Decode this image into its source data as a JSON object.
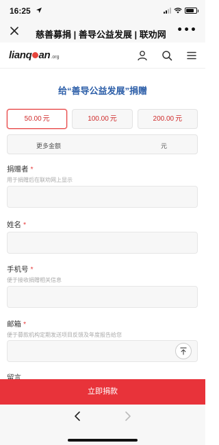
{
  "status_bar": {
    "time": "16:25"
  },
  "app_header": {
    "title": "慈善募捐 | 善导公益发展 | 联劝网"
  },
  "site_logo": {
    "text_before": "lianq",
    "text_after": "an",
    "suffix": ".org"
  },
  "form": {
    "title": "给“善导公益发展”捐赠",
    "amounts": [
      {
        "value": "50.00",
        "unit": "元",
        "selected": true
      },
      {
        "value": "100.00",
        "unit": "元",
        "selected": false
      },
      {
        "value": "200.00",
        "unit": "元",
        "selected": false
      }
    ],
    "custom_amount": {
      "placeholder": "更多金额",
      "unit": "元"
    },
    "fields": {
      "donor": {
        "label": "捐赠者",
        "required_mark": "*",
        "hint": "用于捐赠后在联劝网上显示"
      },
      "name": {
        "label": "姓名",
        "required_mark": "*"
      },
      "phone": {
        "label": "手机号",
        "required_mark": "*",
        "hint": "便于接收捐赠相关信息"
      },
      "email": {
        "label": "邮箱",
        "required_mark": "*",
        "hint": "便于募款机构定期发送项目反馈及年度报告给您"
      },
      "message": {
        "label": "留言"
      }
    },
    "submit_label": "立即捐款"
  },
  "icons": {
    "close": "close-icon",
    "more": "more-icon",
    "user": "user-icon",
    "search": "search-icon",
    "menu": "menu-icon",
    "back_to_top": "back-to-top-icon",
    "nav_back": "chevron-left-icon",
    "nav_forward": "chevron-right-icon"
  },
  "colors": {
    "accent_red": "#e8333a",
    "title_blue": "#2c5ea8"
  }
}
